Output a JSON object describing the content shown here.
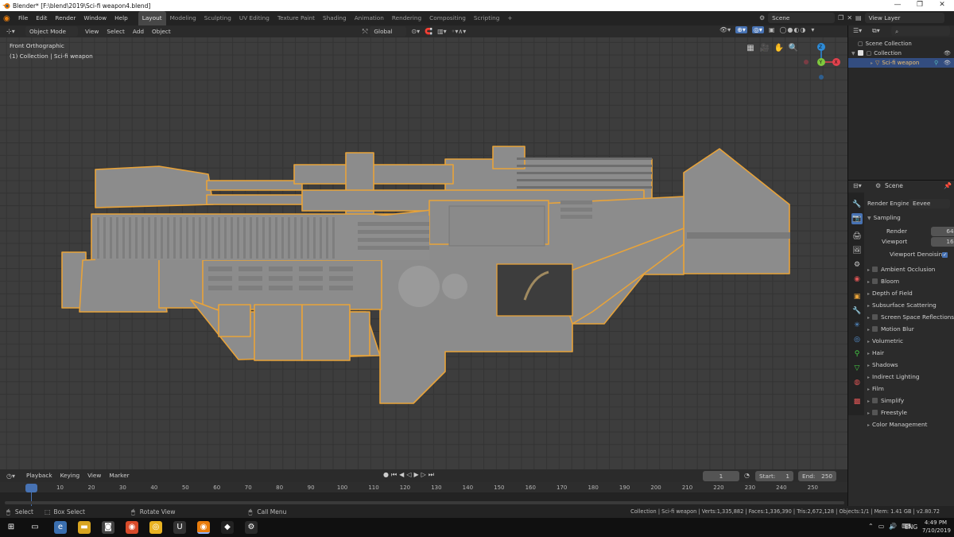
{
  "window": {
    "title": "Blender* [F:\\blend\\2019\\Sci-fi weapon4.blend]",
    "minimize": "—",
    "maximize": "❐",
    "close": "✕"
  },
  "menu": {
    "items": [
      "File",
      "Edit",
      "Render",
      "Window",
      "Help"
    ]
  },
  "workspaces": [
    "Layout",
    "Modeling",
    "Sculpting",
    "UV Editing",
    "Texture Paint",
    "Shading",
    "Animation",
    "Rendering",
    "Compositing",
    "Scripting"
  ],
  "add_workspace": "+",
  "scene": {
    "name": "Scene"
  },
  "view_layer": {
    "name": "View Layer"
  },
  "viewport_header": {
    "mode": "Object Mode",
    "menus": [
      "View",
      "Select",
      "Add",
      "Object"
    ],
    "orientation": "Global"
  },
  "viewport": {
    "view_name": "Front Orthographic",
    "collection_info": "(1) Collection | Sci-fi weapon"
  },
  "gizmo": {
    "x": "X",
    "y": "Y",
    "z": "Z"
  },
  "outliner": {
    "root": "Scene Collection",
    "collection": "Collection",
    "object": "Sci-fi weapon"
  },
  "properties": {
    "scene_label": "Scene",
    "render_engine_label": "Render Engine",
    "render_engine": "Eevee",
    "sampling": {
      "label": "Sampling",
      "render_label": "Render",
      "render": "64",
      "viewport_label": "Viewport",
      "viewport": "16",
      "denoising_label": "Viewport Denoising"
    },
    "panels": [
      {
        "label": "Ambient Occlusion",
        "checkbox": true
      },
      {
        "label": "Bloom",
        "checkbox": true
      },
      {
        "label": "Depth of Field",
        "checkbox": false
      },
      {
        "label": "Subsurface Scattering",
        "checkbox": false
      },
      {
        "label": "Screen Space Reflections",
        "checkbox": true
      },
      {
        "label": "Motion Blur",
        "checkbox": true
      },
      {
        "label": "Volumetric",
        "checkbox": false
      },
      {
        "label": "Hair",
        "checkbox": false
      },
      {
        "label": "Shadows",
        "checkbox": false
      },
      {
        "label": "Indirect Lighting",
        "checkbox": false
      },
      {
        "label": "Film",
        "checkbox": false
      },
      {
        "label": "Simplify",
        "checkbox": true
      },
      {
        "label": "Freestyle",
        "checkbox": true
      },
      {
        "label": "Color Management",
        "checkbox": false
      }
    ]
  },
  "timeline": {
    "menus": [
      "Playback",
      "Keying",
      "View",
      "Marker"
    ],
    "current_frame": "1",
    "start_label": "Start:",
    "start": "1",
    "end_label": "End:",
    "end": "250",
    "ticks": [
      "1",
      "10",
      "20",
      "30",
      "40",
      "50",
      "60",
      "70",
      "80",
      "90",
      "100",
      "110",
      "120",
      "130",
      "140",
      "150",
      "160",
      "170",
      "180",
      "190",
      "200",
      "210",
      "220",
      "230",
      "240",
      "250"
    ]
  },
  "statusbar": {
    "select": "Select",
    "box_select": "Box Select",
    "rotate_view": "Rotate View",
    "call_menu": "Call Menu",
    "info": "Collection | Sci-fi weapon | Verts:1,335,882 | Faces:1,336,390 | Tris:2,672,128 | Objects:1/1 | Mem: 1.41 GB | v2.80.72"
  },
  "taskbar": {
    "time": "4:49 PM",
    "date": "7/10/2019",
    "language": "ENG"
  },
  "colors": {
    "selection_outline": "#e8a33a",
    "active_tab": "#4772b3",
    "x_axis": "#e3414d",
    "y_axis": "#7ec83d",
    "z_axis": "#2d8bd8"
  }
}
